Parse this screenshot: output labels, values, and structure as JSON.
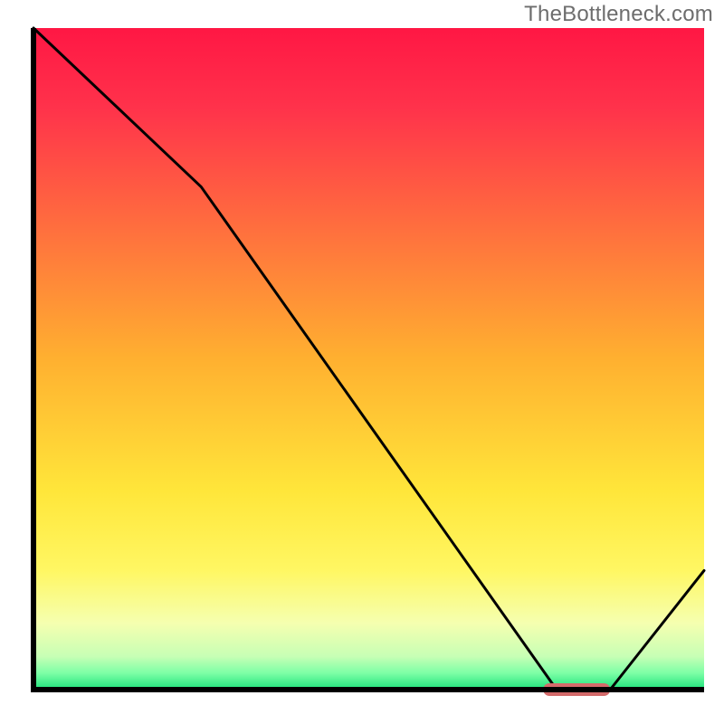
{
  "brand": "TheBottleneck.com",
  "chart_data": {
    "type": "line",
    "title": "",
    "xlabel": "",
    "ylabel": "",
    "xlim": [
      0,
      100
    ],
    "ylim": [
      0,
      100
    ],
    "x": [
      0,
      25,
      78,
      86,
      100
    ],
    "values": [
      100,
      76,
      0,
      0,
      18
    ],
    "marker": {
      "x_start": 76,
      "x_end": 86,
      "y": 0
    },
    "background_gradient": [
      {
        "stop": 0.0,
        "color": "#ff1744"
      },
      {
        "stop": 0.12,
        "color": "#ff324b"
      },
      {
        "stop": 0.5,
        "color": "#ffb030"
      },
      {
        "stop": 0.7,
        "color": "#ffe63a"
      },
      {
        "stop": 0.82,
        "color": "#fff763"
      },
      {
        "stop": 0.9,
        "color": "#f5ffb0"
      },
      {
        "stop": 0.95,
        "color": "#c7ffb5"
      },
      {
        "stop": 0.975,
        "color": "#7dffa6"
      },
      {
        "stop": 1.0,
        "color": "#1de27b"
      }
    ],
    "line_color": "#000000",
    "marker_color": "#d36a6a",
    "axis_color": "#000000"
  },
  "layout": {
    "outer_w": 800,
    "outer_h": 800,
    "inner_left": 37,
    "inner_top": 31,
    "inner_w": 741,
    "inner_h": 731
  }
}
